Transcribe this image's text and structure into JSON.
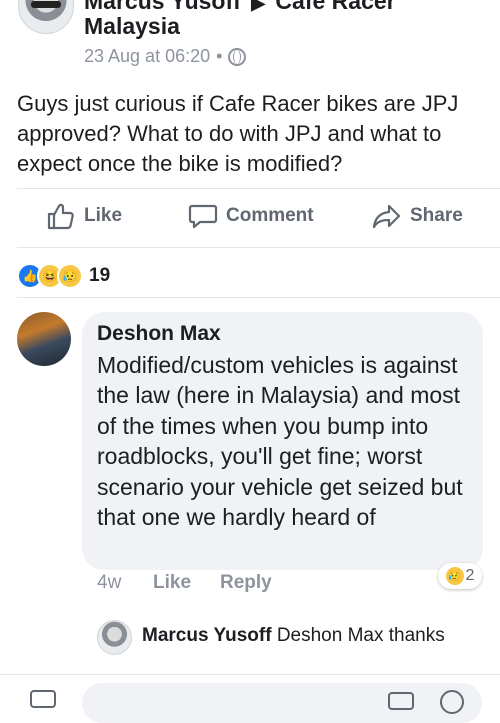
{
  "post": {
    "author": "Marcus Yusoff",
    "group": "Cafe Racer",
    "group_line2": "Malaysia",
    "arrow": "▶",
    "time": "23 Aug at 06:20",
    "dot": "•",
    "text": "Guys just curious if Cafe Racer bikes are JPJ approved? What to do with JPJ and what to expect once the bike is modified?"
  },
  "actions": {
    "like": "Like",
    "comment": "Comment",
    "share": "Share"
  },
  "reactions": {
    "count": "19",
    "types": [
      "like-icon",
      "haha-icon",
      "sad-icon"
    ]
  },
  "comment": {
    "author": "Deshon Max",
    "text": "Modified/custom vehicles is against the law (here in Malaysia) and most of the times when you bump into roadblocks, you'll get fine; worst scenario your vehicle get seized but that one we hardly heard of",
    "time": "4w",
    "like": "Like",
    "reply": "Reply",
    "reaction_count": "2"
  },
  "reply": {
    "author": "Marcus Yusoff",
    "text": "Deshon Max thanks"
  },
  "colors": {
    "accent": "#1877f2",
    "muted": "#8d949e",
    "bubble": "#f0f2f5"
  }
}
